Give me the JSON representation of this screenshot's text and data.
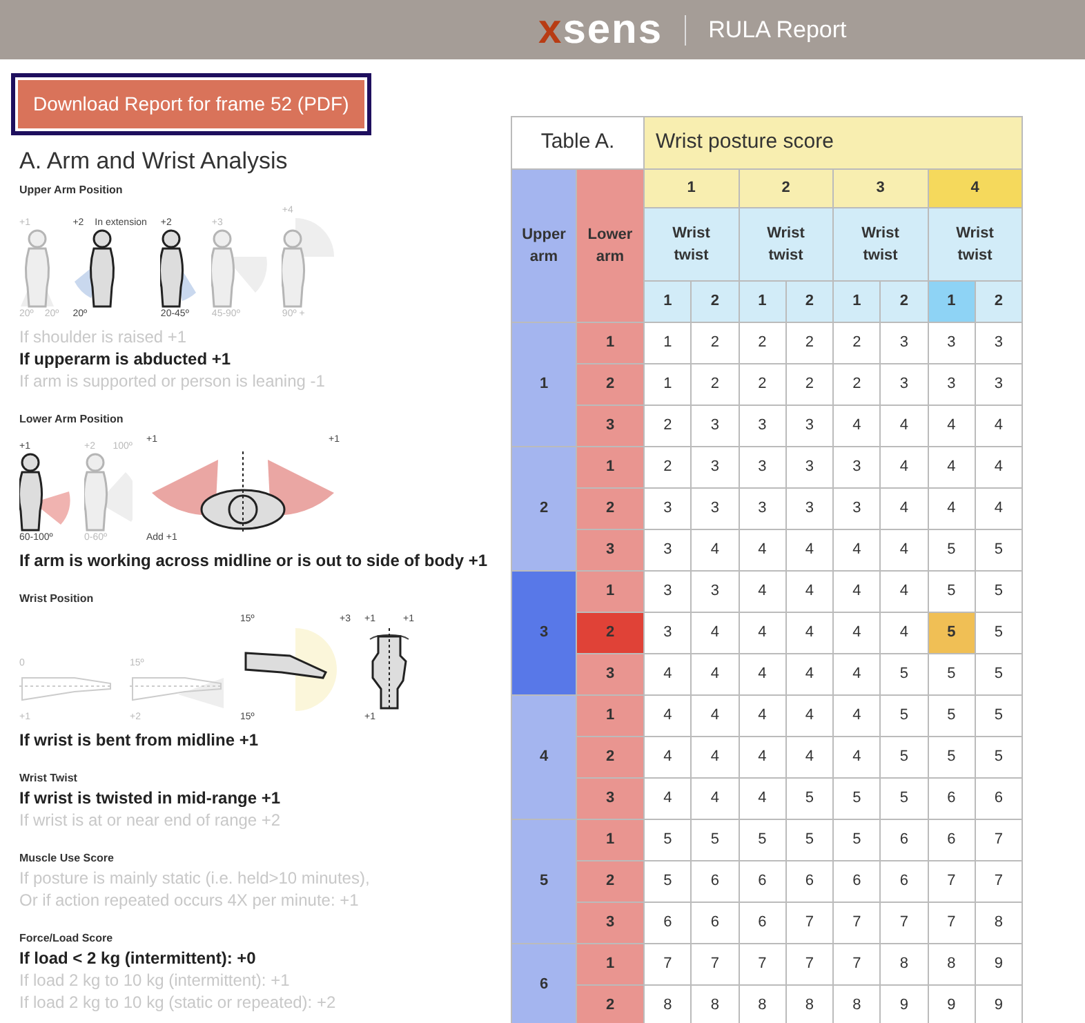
{
  "header": {
    "logo": "xsens",
    "title": "RULA Report"
  },
  "download_button": "Download Report for frame 52 (PDF)",
  "analysis": {
    "title": "A. Arm and Wrist Analysis",
    "sections": [
      {
        "heading": "Upper Arm Position",
        "figures": [
          {
            "kind": "standing",
            "active": false,
            "score": "+1",
            "labels": [
              "20º",
              "20º"
            ]
          },
          {
            "kind": "extension",
            "active": true,
            "score": "+2",
            "note": "In extension",
            "labels": [
              "20º"
            ]
          },
          {
            "kind": "raised",
            "active": true,
            "score": "+2",
            "labels": [
              "20-45º"
            ]
          },
          {
            "kind": "forward",
            "active": false,
            "score": "+3",
            "labels": [
              "45-90º"
            ]
          },
          {
            "kind": "overhead",
            "active": false,
            "score": "+4",
            "labels": [
              "90º +"
            ]
          }
        ],
        "rules": [
          {
            "text": "If shoulder is raised +1",
            "active": false
          },
          {
            "text": "If upperarm is abducted +1",
            "active": true
          },
          {
            "text": "If arm is supported or person is leaning -1",
            "active": false
          }
        ]
      },
      {
        "heading": "Lower Arm Position",
        "figures": [
          {
            "kind": "forearm",
            "active": true,
            "score": "+1",
            "labels": [
              "60-100º"
            ]
          },
          {
            "kind": "forearm-up",
            "active": false,
            "score": "+2",
            "note": "100º",
            "labels": [
              "0-60º"
            ]
          },
          {
            "kind": "top-view",
            "active": true,
            "score": "+1",
            "note": "+1",
            "labels": [
              "Add +1"
            ]
          }
        ],
        "rules": [
          {
            "text": "If arm is working across midline or is out to side of body +1",
            "active": true
          }
        ]
      },
      {
        "heading": "Wrist Position",
        "figures": [
          {
            "kind": "wrist-flat",
            "active": false,
            "score": "0",
            "labels": [
              "+1"
            ]
          },
          {
            "kind": "wrist-tilt",
            "active": false,
            "score": "15º",
            "labels": [
              "+2"
            ]
          },
          {
            "kind": "wrist-bent",
            "active": true,
            "score": "15º",
            "note": "+3",
            "labels": [
              "15º"
            ]
          },
          {
            "kind": "hand",
            "active": true,
            "score": "+1",
            "note": "+1",
            "labels": [
              "+1"
            ]
          }
        ],
        "rules": [
          {
            "text": "If wrist is bent from midline +1",
            "active": true
          }
        ]
      },
      {
        "heading": "Wrist Twist",
        "rules": [
          {
            "text": "If wrist is twisted in mid-range +1",
            "active": true
          },
          {
            "text": "If wrist is at or near end of range +2",
            "active": false
          }
        ]
      },
      {
        "heading": "Muscle Use Score",
        "rules": [
          {
            "text": "If posture is mainly static (i.e. held>10 minutes),",
            "active": false
          },
          {
            "text": "Or if action repeated occurs 4X per minute: +1",
            "active": false
          }
        ]
      },
      {
        "heading": "Force/Load Score",
        "rules": [
          {
            "text": "If load < 2 kg (intermittent): +0",
            "active": true
          },
          {
            "text": "If load 2 kg to 10 kg (intermittent): +1",
            "active": false
          },
          {
            "text": "If load 2 kg to 10 kg (static or repeated): +2",
            "active": false
          }
        ]
      }
    ]
  },
  "table": {
    "title": "Table A.",
    "wrist_header": "Wrist posture score",
    "upper_arm_header": "Upper arm",
    "lower_arm_header": "Lower arm",
    "wrist_scores": [
      {
        "label": "1",
        "selected": false,
        "twist_label": "Wrist twist",
        "twists": [
          {
            "label": "1",
            "selected": false
          },
          {
            "label": "2",
            "selected": false
          }
        ]
      },
      {
        "label": "2",
        "selected": false,
        "twist_label": "Wrist twist",
        "twists": [
          {
            "label": "1",
            "selected": false
          },
          {
            "label": "2",
            "selected": false
          }
        ]
      },
      {
        "label": "3",
        "selected": false,
        "twist_label": "Wrist twist",
        "twists": [
          {
            "label": "1",
            "selected": false
          },
          {
            "label": "2",
            "selected": false
          }
        ]
      },
      {
        "label": "4",
        "selected": true,
        "twist_label": "Wrist twist",
        "twists": [
          {
            "label": "1",
            "selected": true
          },
          {
            "label": "2",
            "selected": false
          }
        ]
      }
    ],
    "groups": [
      {
        "label": "1",
        "selected": false,
        "rows": [
          {
            "label": "1",
            "selected": false,
            "cells": [
              "1",
              "2",
              "2",
              "2",
              "2",
              "3",
              "3",
              "3"
            ]
          },
          {
            "label": "2",
            "selected": false,
            "cells": [
              "1",
              "2",
              "2",
              "2",
              "2",
              "3",
              "3",
              "3"
            ]
          },
          {
            "label": "3",
            "selected": false,
            "cells": [
              "2",
              "3",
              "3",
              "3",
              "4",
              "4",
              "4",
              "4"
            ]
          }
        ]
      },
      {
        "label": "2",
        "selected": false,
        "rows": [
          {
            "label": "1",
            "selected": false,
            "cells": [
              "2",
              "3",
              "3",
              "3",
              "3",
              "4",
              "4",
              "4"
            ]
          },
          {
            "label": "2",
            "selected": false,
            "cells": [
              "3",
              "3",
              "3",
              "3",
              "3",
              "4",
              "4",
              "4"
            ]
          },
          {
            "label": "3",
            "selected": false,
            "cells": [
              "3",
              "4",
              "4",
              "4",
              "4",
              "4",
              "5",
              "5"
            ]
          }
        ]
      },
      {
        "label": "3",
        "selected": true,
        "rows": [
          {
            "label": "1",
            "selected": false,
            "cells": [
              "3",
              "3",
              "4",
              "4",
              "4",
              "4",
              "5",
              "5"
            ]
          },
          {
            "label": "2",
            "selected": true,
            "cells": [
              "3",
              "4",
              "4",
              "4",
              "4",
              "4",
              "5",
              "5"
            ]
          },
          {
            "label": "3",
            "selected": false,
            "cells": [
              "4",
              "4",
              "4",
              "4",
              "4",
              "5",
              "5",
              "5"
            ]
          }
        ]
      },
      {
        "label": "4",
        "selected": false,
        "rows": [
          {
            "label": "1",
            "selected": false,
            "cells": [
              "4",
              "4",
              "4",
              "4",
              "4",
              "5",
              "5",
              "5"
            ]
          },
          {
            "label": "2",
            "selected": false,
            "cells": [
              "4",
              "4",
              "4",
              "4",
              "4",
              "5",
              "5",
              "5"
            ]
          },
          {
            "label": "3",
            "selected": false,
            "cells": [
              "4",
              "4",
              "4",
              "5",
              "5",
              "5",
              "6",
              "6"
            ]
          }
        ]
      },
      {
        "label": "5",
        "selected": false,
        "rows": [
          {
            "label": "1",
            "selected": false,
            "cells": [
              "5",
              "5",
              "5",
              "5",
              "5",
              "6",
              "6",
              "7"
            ]
          },
          {
            "label": "2",
            "selected": false,
            "cells": [
              "5",
              "6",
              "6",
              "6",
              "6",
              "6",
              "7",
              "7"
            ]
          },
          {
            "label": "3",
            "selected": false,
            "cells": [
              "6",
              "6",
              "6",
              "7",
              "7",
              "7",
              "7",
              "8"
            ]
          }
        ]
      },
      {
        "label": "6",
        "selected": false,
        "rows": [
          {
            "label": "1",
            "selected": false,
            "cells": [
              "7",
              "7",
              "7",
              "7",
              "7",
              "8",
              "8",
              "9"
            ]
          },
          {
            "label": "2",
            "selected": false,
            "cells": [
              "8",
              "8",
              "8",
              "8",
              "8",
              "9",
              "9",
              "9"
            ]
          }
        ]
      }
    ]
  }
}
